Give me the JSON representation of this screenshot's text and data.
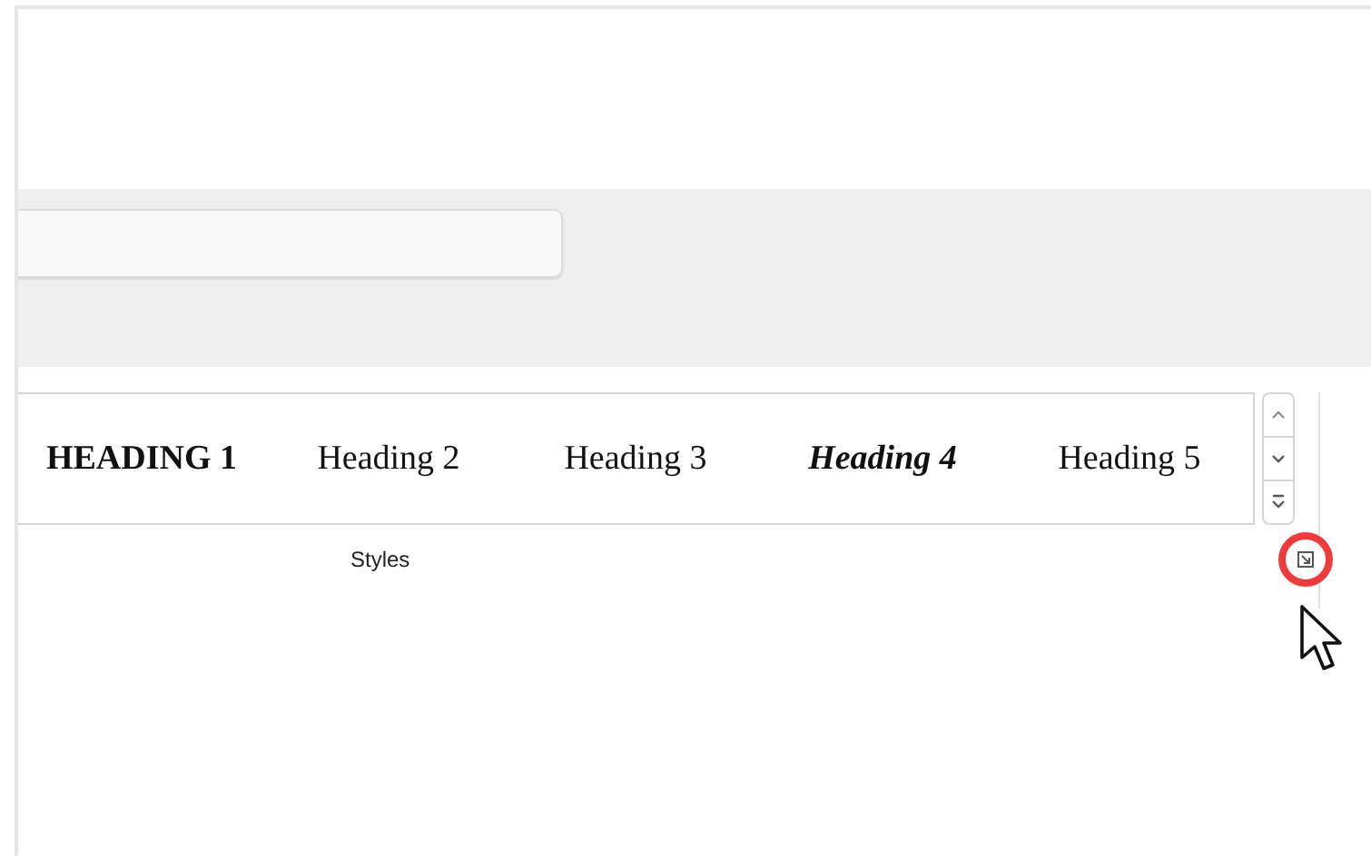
{
  "styles_gallery": {
    "items": [
      {
        "label": "HEADING 1",
        "kind": "bold"
      },
      {
        "label": "Heading 2",
        "kind": "normal"
      },
      {
        "label": "Heading 3",
        "kind": "normal"
      },
      {
        "label": "Heading 4",
        "kind": "emphasis"
      },
      {
        "label": "Heading 5",
        "kind": "normal"
      }
    ]
  },
  "group_label": "Styles",
  "dialog_launcher": {
    "highlighted": true
  }
}
